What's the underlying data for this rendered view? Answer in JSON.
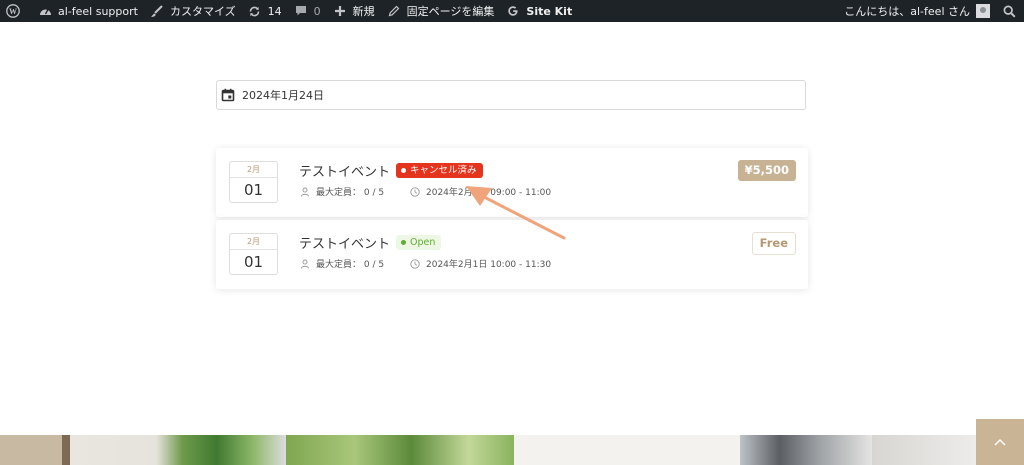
{
  "adminbar": {
    "site_name": "al-feel support",
    "customize": "カスタマイズ",
    "updates_count": "14",
    "comments_count": "0",
    "new": "新規",
    "edit_page": "固定ページを編集",
    "site_kit": "Site Kit",
    "greeting": "こんにちは、al-feel さん"
  },
  "date_filter": {
    "value": "2024年1月24日"
  },
  "events": [
    {
      "month": "2月",
      "day": "01",
      "title": "テストイベント",
      "status": "キャンセル済み",
      "capacity_label": "最大定員： 0 / 5",
      "time": "2024年2月1日 09:00 - 11:00",
      "price": "¥5,500"
    },
    {
      "month": "2月",
      "day": "01",
      "title": "テストイベント",
      "status": "Open",
      "capacity_label": "最大定員： 0 / 5",
      "time": "2024年2月1日 10:00 - 11:30",
      "price": "Free"
    }
  ],
  "colors": {
    "adminbar_bg": "#1d2327",
    "cancel_badge": "#e5341e",
    "open_badge_text": "#5fae2e",
    "price_paid_bg": "#c7b394",
    "accent_gold": "#b39a72",
    "annotation_arrow": "#f0a47c"
  },
  "icons": {
    "wordpress": "wordpress-logo-icon",
    "dashboard": "dashboard-icon",
    "customize": "brush-icon",
    "updates": "refresh-icon",
    "comments": "comment-icon",
    "new": "plus-icon",
    "edit": "pencil-icon",
    "site_kit": "google-g-icon",
    "search": "search-icon",
    "calendar": "calendar-icon",
    "person": "person-icon",
    "clock": "clock-icon"
  }
}
